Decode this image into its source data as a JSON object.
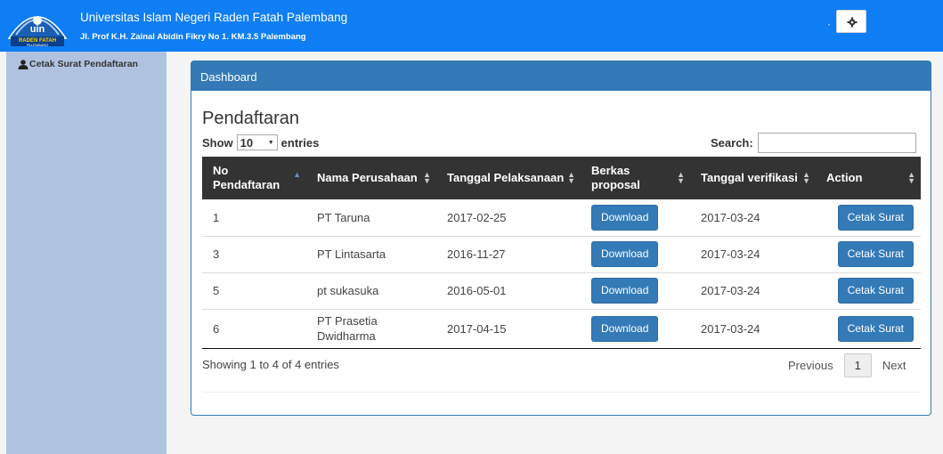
{
  "header": {
    "university_name": "Universitas Islam Negeri Raden Fatah Palembang",
    "address": "Jl. Prof K.H. Zainal Abidin Fikry No 1. KM.3.5 Palembang",
    "logo_text": "uin",
    "logo_sub": "RADEN FATAH",
    "logo_sub2": "PALEMBANG",
    "dot": "·"
  },
  "sidebar": {
    "items": [
      {
        "label": "Cetak Surat Pendaftaran",
        "icon": "user-icon"
      }
    ]
  },
  "panel": {
    "heading": "Dashboard",
    "title": "Pendaftaran"
  },
  "table_controls": {
    "show_label": "Show",
    "entries_label": "entries",
    "length_value": "10",
    "search_label": "Search:",
    "search_value": ""
  },
  "table": {
    "columns": [
      "No Pendaftaran",
      "Nama Perusahaan",
      "Tanggal Pelaksanaan",
      "Berkas proposal",
      "Tanggal verifikasi",
      "Action"
    ],
    "rows": [
      {
        "no": "1",
        "nama": "PT Taruna",
        "tanggal": "2017-02-25",
        "berkas": "Download",
        "verifikasi": "2017-03-24",
        "action": "Cetak Surat"
      },
      {
        "no": "3",
        "nama": "PT Lintasarta",
        "tanggal": "2016-11-27",
        "berkas": "Download",
        "verifikasi": "2017-03-24",
        "action": "Cetak Surat"
      },
      {
        "no": "5",
        "nama": "pt sukasuka",
        "tanggal": "2016-05-01",
        "berkas": "Download",
        "verifikasi": "2017-03-24",
        "action": "Cetak Surat"
      },
      {
        "no": "6",
        "nama": "PT Prasetia Dwidharma",
        "tanggal": "2017-04-15",
        "berkas": "Download",
        "verifikasi": "2017-03-24",
        "action": "Cetak Surat"
      }
    ]
  },
  "footer": {
    "info": "Showing 1 to 4 of 4 entries",
    "prev": "Previous",
    "page": "1",
    "next": "Next"
  },
  "colors": {
    "topbar": "#0f7ef4",
    "sidebar": "#afc3e0",
    "primary": "#337ab7",
    "table_header": "#333333"
  }
}
